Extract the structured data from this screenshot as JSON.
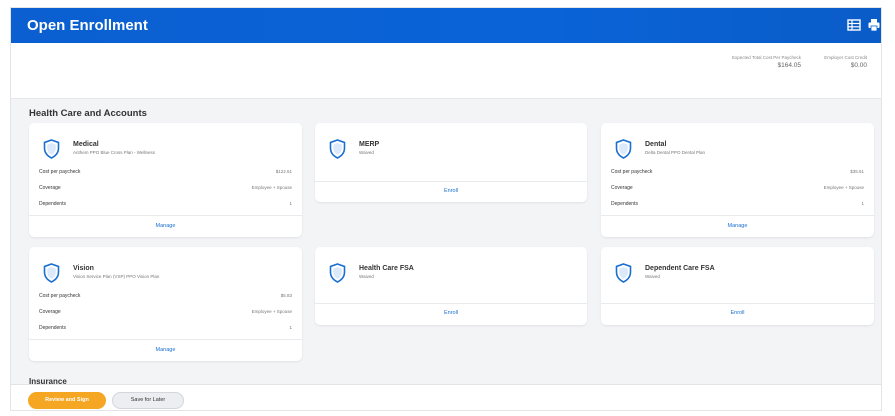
{
  "header": {
    "title": "Open Enrollment",
    "icons": [
      "table-icon",
      "print-icon"
    ]
  },
  "summary": {
    "items": [
      {
        "label": "Expected Total Cost Per Paycheck",
        "value": "$164.05"
      },
      {
        "label": "Employer Cost Credit",
        "value": "$0.00"
      }
    ]
  },
  "section": {
    "title": "Health Care and Accounts"
  },
  "cards": {
    "medical": {
      "name": "Medical",
      "subtitle": "Anthem PPO Blue Cross Plan - Wellness",
      "rows": [
        {
          "label": "Cost per paycheck",
          "value": "$122.61"
        },
        {
          "label": "Coverage",
          "value": "Employee + Spouse"
        },
        {
          "label": "Dependents",
          "value": "1"
        }
      ],
      "action": "Manage"
    },
    "merp": {
      "name": "MERP",
      "subtitle": "Waived",
      "action": "Enroll"
    },
    "dental": {
      "name": "Dental",
      "subtitle": "Delta Dental PPO Dental Plan",
      "rows": [
        {
          "label": "Cost per paycheck",
          "value": "$35.61"
        },
        {
          "label": "Coverage",
          "value": "Employee + Spouse"
        },
        {
          "label": "Dependents",
          "value": "1"
        }
      ],
      "action": "Manage"
    },
    "vision": {
      "name": "Vision",
      "subtitle": "Vision Service Plan (VSP) PPO Vision Plan",
      "rows": [
        {
          "label": "Cost per paycheck",
          "value": "$5.83"
        },
        {
          "label": "Coverage",
          "value": "Employee + Spouse"
        },
        {
          "label": "Dependents",
          "value": "1"
        }
      ],
      "action": "Manage"
    },
    "hcfsa": {
      "name": "Health Care FSA",
      "subtitle": "Waived",
      "action": "Enroll"
    },
    "dcfsa": {
      "name": "Dependent Care FSA",
      "subtitle": "Waived",
      "action": "Enroll"
    }
  },
  "section2": {
    "title": "Insurance"
  },
  "footer": {
    "primary": "Review and Sign",
    "secondary": "Save for Later"
  },
  "colors": {
    "header": "#0b5fd0",
    "accent": "#f5a623",
    "link": "#1a6fd1"
  }
}
